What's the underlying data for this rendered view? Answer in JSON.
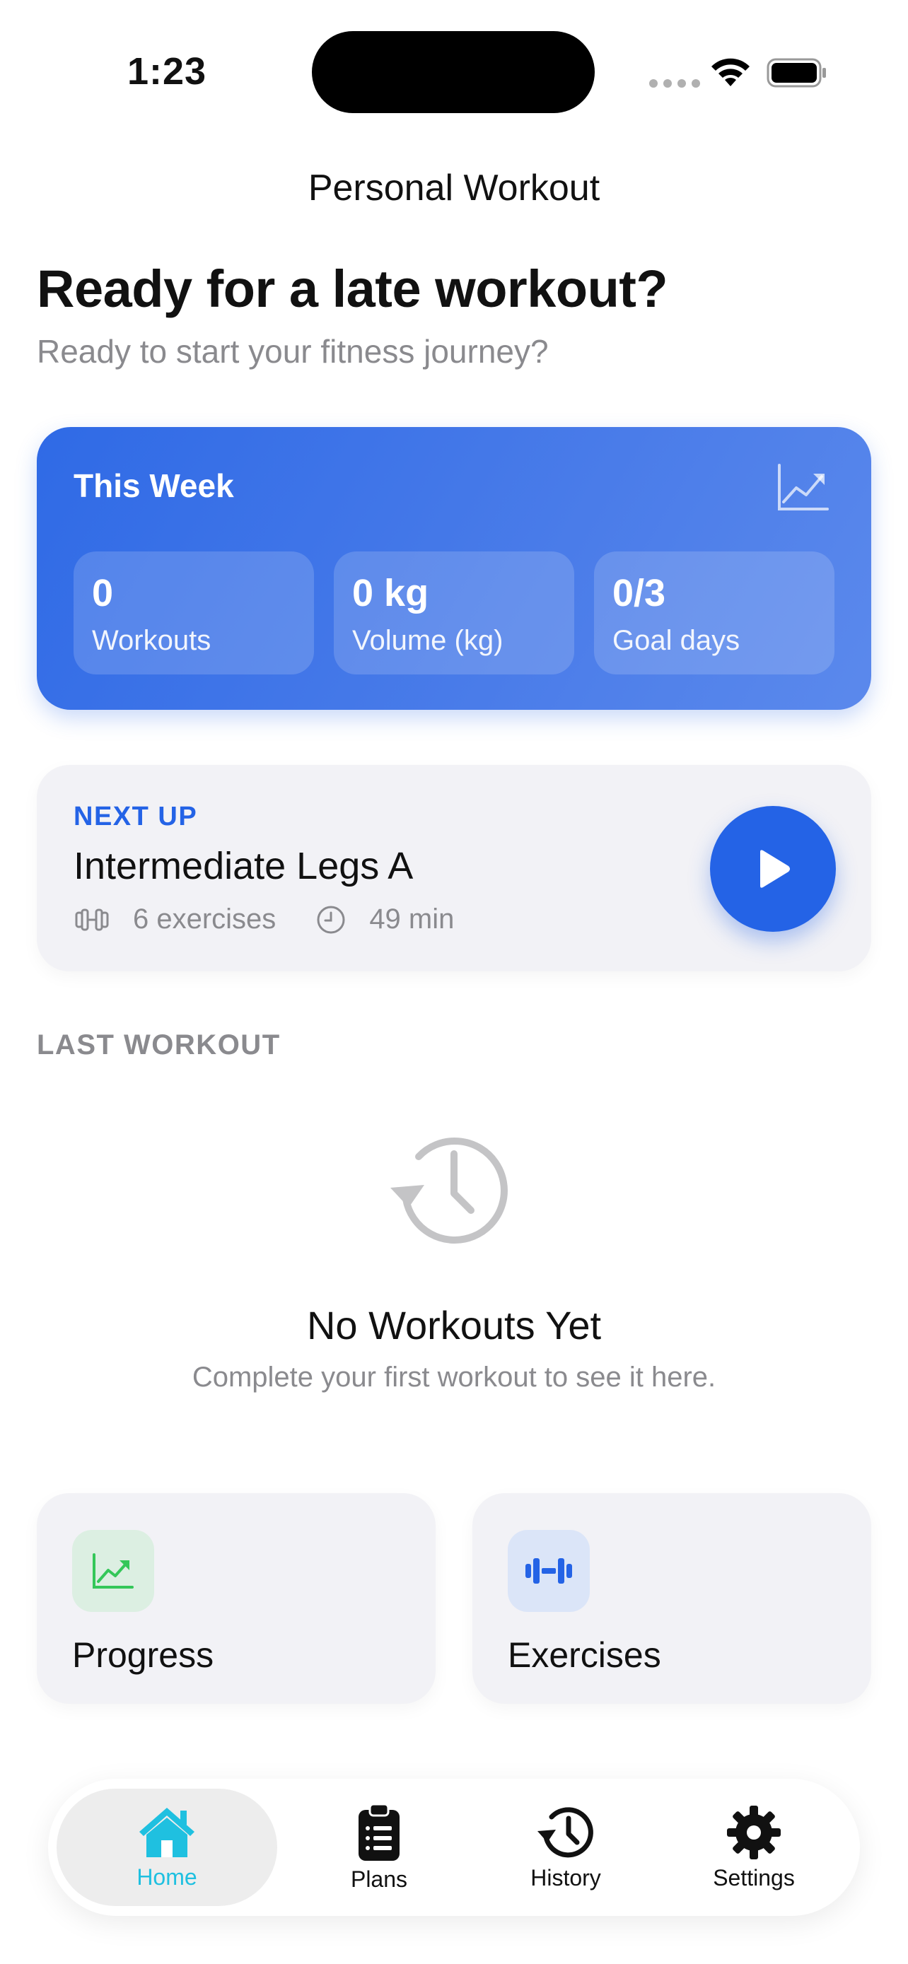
{
  "status_bar": {
    "time": "1:23"
  },
  "nav": {
    "title": "Personal Workout"
  },
  "hero": {
    "title": "Ready for a late workout?",
    "subtitle": "Ready to start your fitness journey?"
  },
  "week": {
    "title": "This Week",
    "icon": "chart-line-icon",
    "stats": [
      {
        "value": "0",
        "label": "Workouts"
      },
      {
        "value": "0 kg",
        "label": "Volume (kg)"
      },
      {
        "value": "0/3",
        "label": "Goal days"
      }
    ]
  },
  "next_up": {
    "tag": "NEXT UP",
    "title": "Intermediate Legs A",
    "exercises": "6 exercises",
    "duration": "49 min"
  },
  "last_workout": {
    "label": "LAST WORKOUT",
    "empty_title": "No Workouts Yet",
    "empty_subtitle": "Complete your first workout to see it here."
  },
  "tiles": [
    {
      "label": "Progress",
      "icon": "progress-chart-icon",
      "color": "#34c759"
    },
    {
      "label": "Exercises",
      "icon": "dumbbell-icon",
      "color": "#2463e6"
    }
  ],
  "tabbar": {
    "items": [
      {
        "label": "Home",
        "icon": "home-icon",
        "active": true
      },
      {
        "label": "Plans",
        "icon": "clipboard-icon",
        "active": false
      },
      {
        "label": "History",
        "icon": "history-icon",
        "active": false
      },
      {
        "label": "Settings",
        "icon": "gear-icon",
        "active": false
      }
    ],
    "active_color": "#1fc0e0"
  },
  "colors": {
    "accent": "#2463e6",
    "muted": "#8a8a8e"
  }
}
